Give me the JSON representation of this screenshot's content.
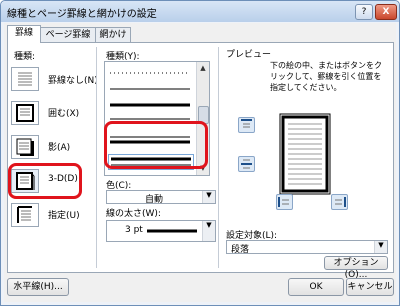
{
  "window": {
    "title": "線種とページ罫線と網かけの設定",
    "help_label": "?",
    "close_label": "X"
  },
  "tabs": [
    {
      "label": "罫線",
      "active": true
    },
    {
      "label": "ページ罫線",
      "active": false
    },
    {
      "label": "網かけ",
      "active": false
    }
  ],
  "setting": {
    "header": "種類:",
    "items": [
      {
        "label": "罫線なし(N)",
        "icon": "no-border-icon"
      },
      {
        "label": "囲む(X)",
        "icon": "box-border-icon"
      },
      {
        "label": "影(A)",
        "icon": "shadow-border-icon"
      },
      {
        "label": "3-D(D)",
        "icon": "3d-border-icon",
        "selected": true
      },
      {
        "label": "指定(U)",
        "icon": "custom-border-icon"
      }
    ]
  },
  "style": {
    "header": "種類(Y):",
    "items": [
      "dotted",
      "thin-line",
      "thick-line",
      "double",
      "thick-thin",
      "thin-thick"
    ]
  },
  "color": {
    "label": "色(C):",
    "value": "自動"
  },
  "width": {
    "label": "線の太さ(W):",
    "value": "3 pt"
  },
  "preview": {
    "header": "プレビュー",
    "instructions": "下の絵の中、またはボタンをクリックして、罫線を引く位置を指定してください。"
  },
  "apply_to": {
    "label": "設定対象(L):",
    "value": "段落"
  },
  "buttons": {
    "options": "オプション(O)...",
    "horizontal_line": "水平線(H)...",
    "ok": "OK",
    "cancel": "キャンセル"
  },
  "colors": {
    "highlight": "#e0141c",
    "accent": "#b9cfea"
  }
}
